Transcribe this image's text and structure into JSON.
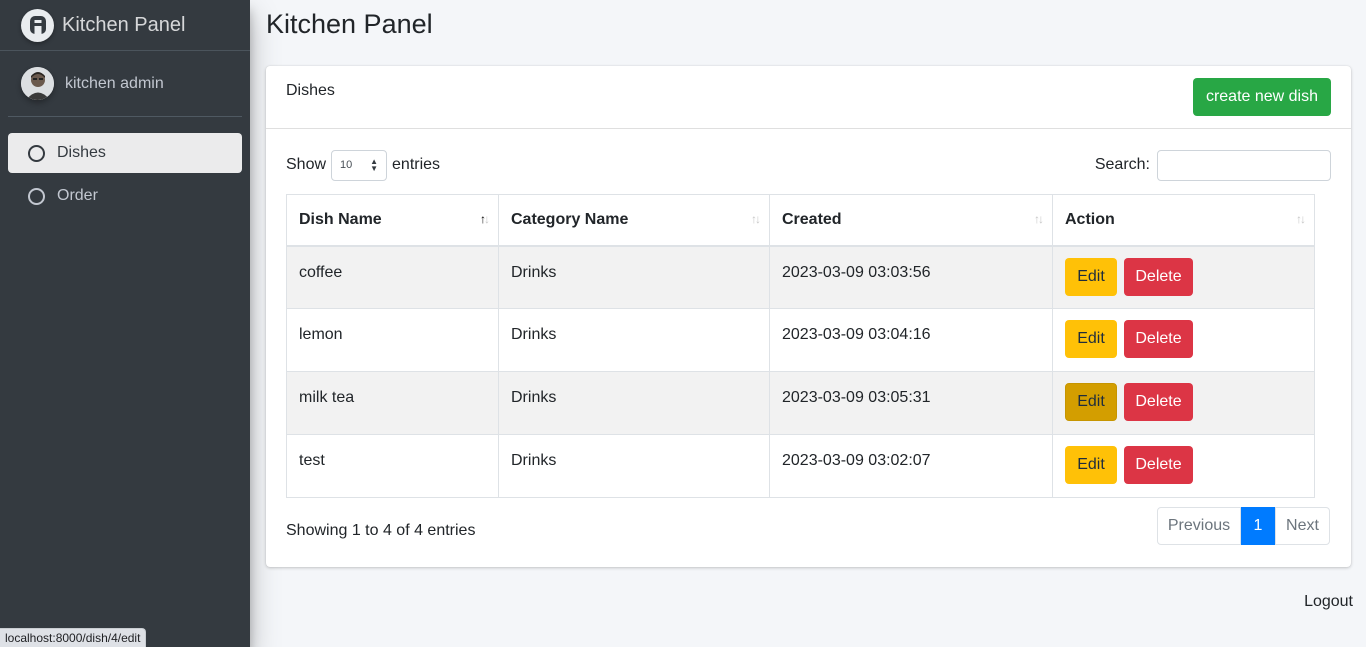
{
  "brand": {
    "title": "Kitchen Panel",
    "logo_icon": "app-logo-icon"
  },
  "user": {
    "name": "kitchen admin"
  },
  "sidebar": {
    "items": [
      {
        "label": "Dishes",
        "active": true
      },
      {
        "label": "Order",
        "active": false
      }
    ]
  },
  "page": {
    "title": "Kitchen Panel"
  },
  "card": {
    "title": "Dishes",
    "create_label": "create new dish"
  },
  "controls": {
    "show_label": "Show",
    "entries_value": "10",
    "entries_label": "entries",
    "search_label": "Search:",
    "search_value": ""
  },
  "table": {
    "headers": [
      "Dish Name",
      "Category Name",
      "Created",
      "Action"
    ],
    "sorted_column": "Dish Name",
    "sort_direction": "ascending",
    "rows": [
      {
        "dish": "coffee",
        "category": "Drinks",
        "created": "2023-03-09 03:03:56",
        "edit": "Edit",
        "delete": "Delete"
      },
      {
        "dish": "lemon",
        "category": "Drinks",
        "created": "2023-03-09 03:04:16",
        "edit": "Edit",
        "delete": "Delete"
      },
      {
        "dish": "milk tea",
        "category": "Drinks",
        "created": "2023-03-09 03:05:31",
        "edit": "Edit",
        "delete": "Delete"
      },
      {
        "dish": "test",
        "category": "Drinks",
        "created": "2023-03-09 03:02:07",
        "edit": "Edit",
        "delete": "Delete"
      }
    ]
  },
  "footer": {
    "info": "Showing 1 to 4 of 4 entries",
    "previous": "Previous",
    "current_page": "1",
    "next": "Next"
  },
  "logout": "Logout",
  "status_bar": {
    "url": "localhost:8000/dish/4/edit"
  },
  "colors": {
    "sidebar_bg": "#343a40",
    "success": "#28a745",
    "warning": "#ffc107",
    "danger": "#dc3545",
    "primary": "#007bff"
  }
}
